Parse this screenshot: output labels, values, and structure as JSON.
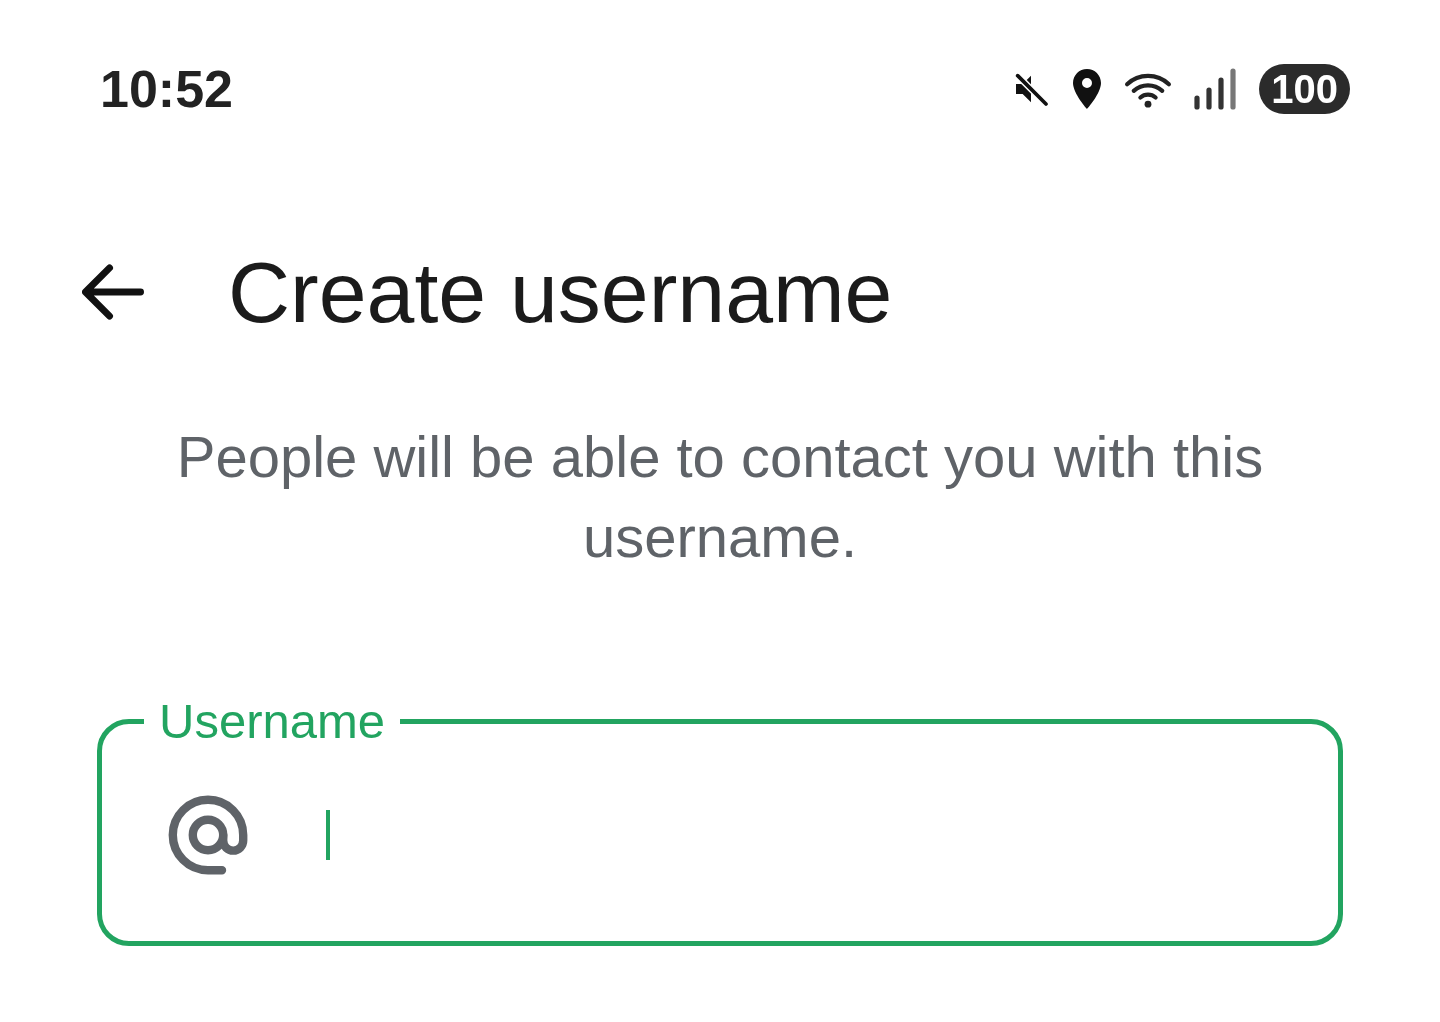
{
  "status_bar": {
    "time": "10:52",
    "battery": "100"
  },
  "header": {
    "title": "Create username"
  },
  "description": "People will be able to contact you with this username.",
  "username_field": {
    "label": "Username",
    "focused": true
  }
}
